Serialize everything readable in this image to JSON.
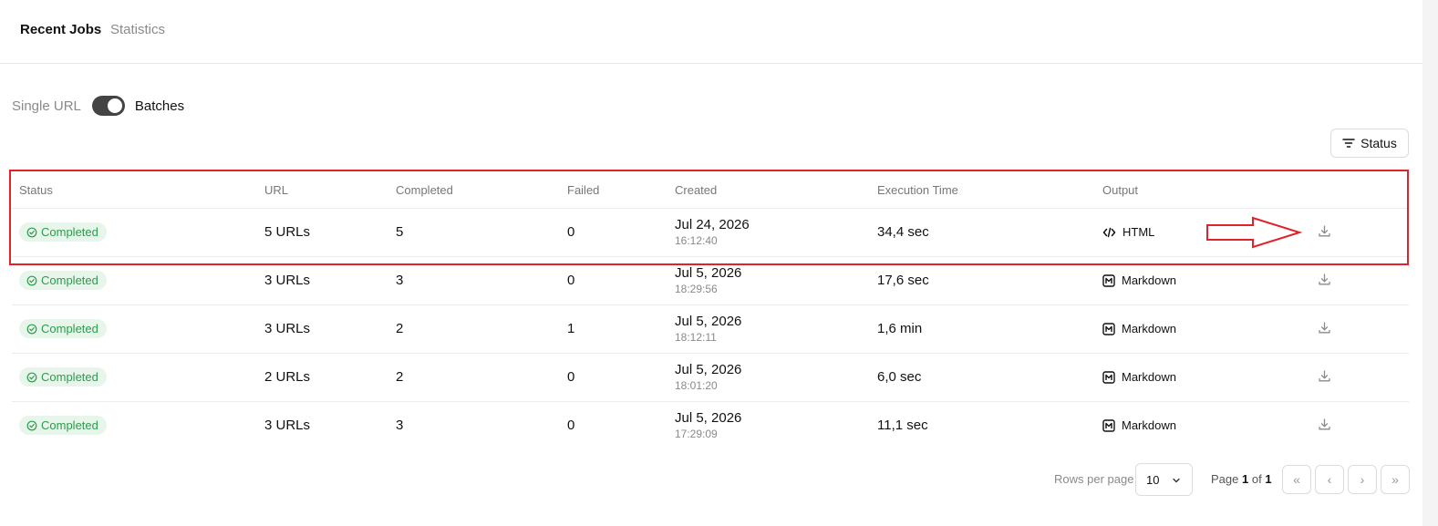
{
  "tabs": [
    {
      "label": "Recent Jobs",
      "active": true
    },
    {
      "label": "Statistics",
      "active": false
    }
  ],
  "mode_toggle": {
    "off_label": "Single URL",
    "on_label": "Batches",
    "on": true
  },
  "filter_button": {
    "label": "Status",
    "icon": "filter-icon"
  },
  "table": {
    "headers": [
      "Status",
      "URL",
      "Completed",
      "Failed",
      "Created",
      "Execution Time",
      "Output"
    ],
    "rows": [
      {
        "status": "Completed",
        "url": "5 URLs",
        "completed": "5",
        "failed": "0",
        "date": "Jul 24, 2026",
        "time": "16:12:40",
        "exec": "34,4 sec",
        "output": "HTML",
        "output_icon": "code-icon"
      },
      {
        "status": "Completed",
        "url": "3 URLs",
        "completed": "3",
        "failed": "0",
        "date": "Jul 5, 2026",
        "time": "18:29:56",
        "exec": "17,6 sec",
        "output": "Markdown",
        "output_icon": "markdown-icon"
      },
      {
        "status": "Completed",
        "url": "3 URLs",
        "completed": "2",
        "failed": "1",
        "date": "Jul 5, 2026",
        "time": "18:12:11",
        "exec": "1,6 min",
        "output": "Markdown",
        "output_icon": "markdown-icon"
      },
      {
        "status": "Completed",
        "url": "2 URLs",
        "completed": "2",
        "failed": "0",
        "date": "Jul 5, 2026",
        "time": "18:01:20",
        "exec": "6,0 sec",
        "output": "Markdown",
        "output_icon": "markdown-icon"
      },
      {
        "status": "Completed",
        "url": "3 URLs",
        "completed": "3",
        "failed": "0",
        "date": "Jul 5, 2026",
        "time": "17:29:09",
        "exec": "11,1 sec",
        "output": "Markdown",
        "output_icon": "markdown-icon"
      }
    ]
  },
  "pagination": {
    "rows_per_page_label": "Rows per page",
    "rows_per_page_value": "10",
    "page_prefix": "Page",
    "current_page": "1",
    "of_label": "of",
    "total_pages": "1",
    "buttons": [
      "«",
      "‹",
      "›",
      "»"
    ]
  },
  "colors": {
    "accent_dark": "#444444",
    "success_text": "#2e9b4d",
    "success_bg": "#e7f5ea",
    "annotation_red": "#e0222a"
  }
}
